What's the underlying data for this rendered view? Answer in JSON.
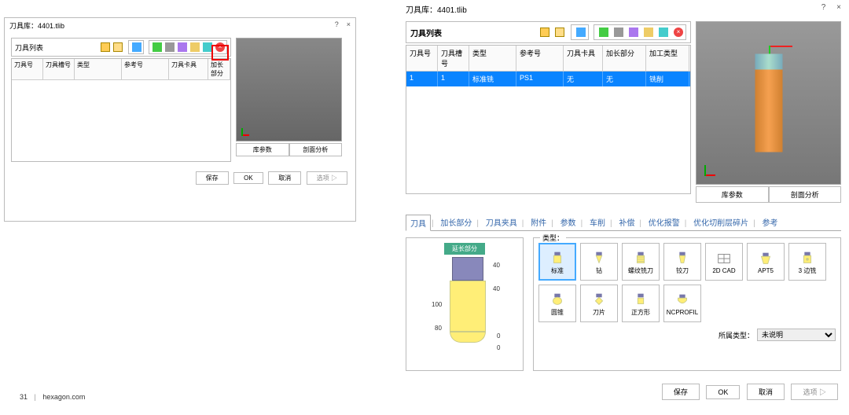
{
  "left": {
    "title": "刀具库：4401.tlib",
    "list_label": "刀具列表",
    "help": "?",
    "close": "×",
    "columns": {
      "num": "刀具号",
      "slot": "刀具槽号",
      "type": "类型",
      "ref": "参考号",
      "holder": "刀具卡具",
      "ext": "加长部分"
    },
    "below": {
      "params": "库参数",
      "section": "剖面分析"
    },
    "footer": {
      "save": "保存",
      "ok": "OK",
      "cancel": "取消",
      "select": "选项 ▷"
    }
  },
  "footer_page": {
    "num": "31",
    "sep": "|",
    "site": "hexagon.com"
  },
  "right": {
    "title": "刀具库：4401.tlib",
    "list_label": "刀具列表",
    "help": "?",
    "close": "×",
    "columns": {
      "num": "刀具号",
      "slot": "刀具槽号",
      "type": "类型",
      "ref": "参考号",
      "holder": "刀具卡具",
      "ext": "加长部分",
      "mtype": "加工类型"
    },
    "row1": {
      "num": "1",
      "slot": "1",
      "type": "标准铣",
      "ref": "PS1",
      "holder": "无",
      "ext": "无",
      "mtype": "铣削"
    },
    "below": {
      "params": "库参数",
      "section": "剖面分析"
    },
    "tabs": [
      "刀具",
      "加长部分",
      "刀具夹具",
      "附件",
      "参数",
      "车削",
      "补偿",
      "优化报警",
      "优化切削层碎片",
      "参考"
    ],
    "diagram": {
      "ext_label": "延长部分",
      "d100": "100",
      "d80": "80",
      "d40a": "40",
      "d40b": "40",
      "d0a": "0",
      "d0b": "0"
    },
    "type_label": "类型：",
    "types": [
      "标准",
      "钻",
      "螺纹铣刀",
      "铰刀",
      "2D CAD",
      "APT5",
      "3 边铣",
      "圆锥",
      "刀片",
      "正方形",
      "NCPROFIL"
    ],
    "belong_label": "所属类型：",
    "belong_value": "未说明",
    "footer": {
      "save": "保存",
      "ok": "OK",
      "cancel": "取消",
      "select": "选项 ▷"
    }
  }
}
